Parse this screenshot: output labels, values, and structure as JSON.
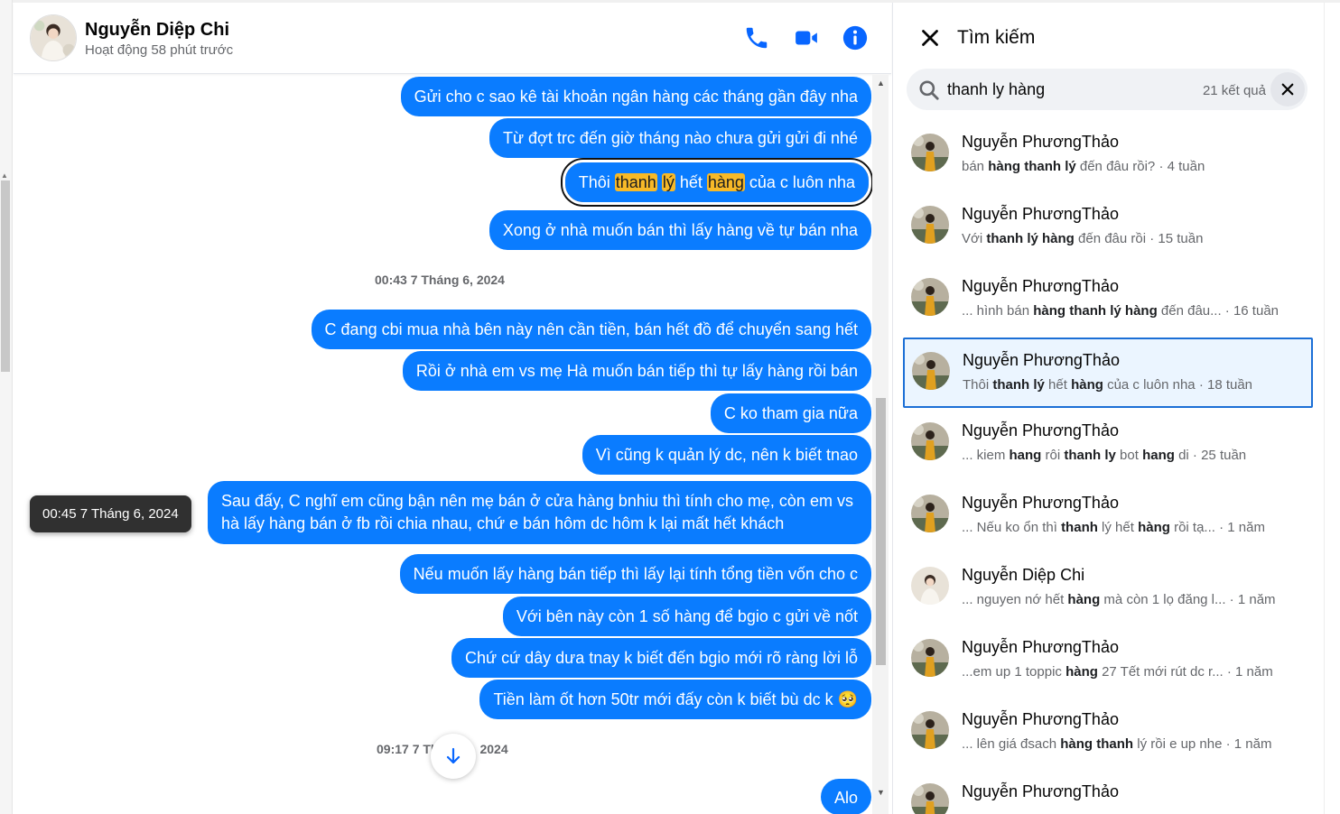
{
  "header": {
    "name": "Nguyễn Diệp Chi",
    "status": "Hoạt động 58 phút trước",
    "call_icon": "phone-icon",
    "video_icon": "video-camera-icon",
    "info_icon": "info-icon"
  },
  "messages": [
    {
      "text": "Gửi cho c sao kê tài khoản ngân hàng các tháng gần đây nha"
    },
    {
      "text": "Từ đợt trc đến giờ tháng nào chưa gửi gửi đi nhé"
    },
    {
      "parts": [
        "Thôi ",
        "thanh",
        " ",
        "lý",
        " hết ",
        "hàng",
        " của c luôn nha"
      ]
    },
    {
      "text": "Xong ở nhà muốn bán thì lấy hàng về tự bán nha"
    },
    {
      "text": "C đang cbi mua nhà bên này nên cần tiền, bán hết đồ để chuyển sang hết"
    },
    {
      "text": "Rồi ở nhà em vs mẹ Hà muốn bán tiếp thì tự lấy hàng rồi bán"
    },
    {
      "text": "C ko tham gia nữa"
    },
    {
      "text": "Vì cũng k quản lý dc, nên k biết tnao"
    },
    {
      "text": "Sau đấy, C nghĩ em cũng bận nên mẹ bán ở cửa hàng bnhiu thì tính cho mẹ, còn em vs hà lấy hàng bán ở fb rồi chia nhau, chứ e bán hôm dc hôm k lại mất hết khách"
    },
    {
      "text": "Nếu muốn lấy hàng bán tiếp thì lấy lại tính tổng tiền vốn cho c"
    },
    {
      "text": "Với bên này còn 1 số hàng để bgio c gửi về nốt"
    },
    {
      "text": "Chứ cứ dây dưa tnay k biết đến bgio mới rõ ràng lời lỗ"
    },
    {
      "text": "Tiền làm ốt hơn 50tr mới đấy còn k biết bù dc k 🥺"
    },
    {
      "text": "Alo"
    }
  ],
  "timestamps": {
    "t1": "00:43 7 Tháng 6, 2024",
    "t2_left": "09:17 7 Th",
    "t2_right": "2024"
  },
  "tooltip": "00:45 7 Tháng 6, 2024",
  "search_panel": {
    "title": "Tìm kiếm",
    "query": "thanh ly hàng",
    "result_count": "21 kết quả",
    "results": [
      {
        "name": "Nguyễn PhươngThảo",
        "snippet": [
          [
            "bán ",
            false
          ],
          [
            "hàng thanh lý",
            true
          ],
          [
            " đến đâu rồi? · 4 tuần",
            false
          ]
        ]
      },
      {
        "name": "Nguyễn PhươngThảo",
        "snippet": [
          [
            "Với ",
            false
          ],
          [
            "thanh lý hàng",
            true
          ],
          [
            " đến đâu rồi · 15 tuần",
            false
          ]
        ]
      },
      {
        "name": "Nguyễn PhươngThảo",
        "snippet": [
          [
            "... hình bán ",
            false
          ],
          [
            "hàng thanh lý hàng",
            true
          ],
          [
            " đến đâu... · 16 tuần",
            false
          ]
        ]
      },
      {
        "name": "Nguyễn PhươngThảo",
        "snippet": [
          [
            "Thôi ",
            false
          ],
          [
            "thanh lý",
            true
          ],
          [
            " hết ",
            false
          ],
          [
            "hàng",
            true
          ],
          [
            " của c luôn nha · 18 tuần",
            false
          ]
        ]
      },
      {
        "name": "Nguyễn PhươngThảo",
        "snippet": [
          [
            "... kiem ",
            false
          ],
          [
            "hang",
            true
          ],
          [
            " rôi ",
            false
          ],
          [
            "thanh ly",
            true
          ],
          [
            " bot ",
            false
          ],
          [
            "hang",
            true
          ],
          [
            " di · 25 tuần",
            false
          ]
        ]
      },
      {
        "name": "Nguyễn PhươngThảo",
        "snippet": [
          [
            "... Nếu ko ổn thì ",
            false
          ],
          [
            "thanh",
            true
          ],
          [
            " lý hết ",
            false
          ],
          [
            "hàng",
            true
          ],
          [
            " rồi tạ...    · 1 năm",
            false
          ]
        ]
      },
      {
        "name": "Nguyễn Diệp Chi",
        "snippet": [
          [
            "... nguyen nớ hết ",
            false
          ],
          [
            "hàng",
            true
          ],
          [
            " mà còn 1 lọ đăng l... · 1 năm",
            false
          ]
        ]
      },
      {
        "name": "Nguyễn PhươngThảo",
        "snippet": [
          [
            "...em up 1 toppic ",
            false
          ],
          [
            "hàng",
            true
          ],
          [
            " 27 Tết mới rút dc r... · 1 năm",
            false
          ]
        ]
      },
      {
        "name": "Nguyễn PhươngThảo",
        "snippet": [
          [
            "... lên giá đsach ",
            false
          ],
          [
            "hàng thanh",
            true
          ],
          [
            " lý rồi e up nhe · 1 năm",
            false
          ]
        ]
      },
      {
        "name": "Nguyễn PhươngThảo",
        "snippet": []
      }
    ]
  },
  "colors": {
    "bubble": "#0a7cff",
    "highlight": "#f7b928",
    "accent": "#0866ff"
  }
}
